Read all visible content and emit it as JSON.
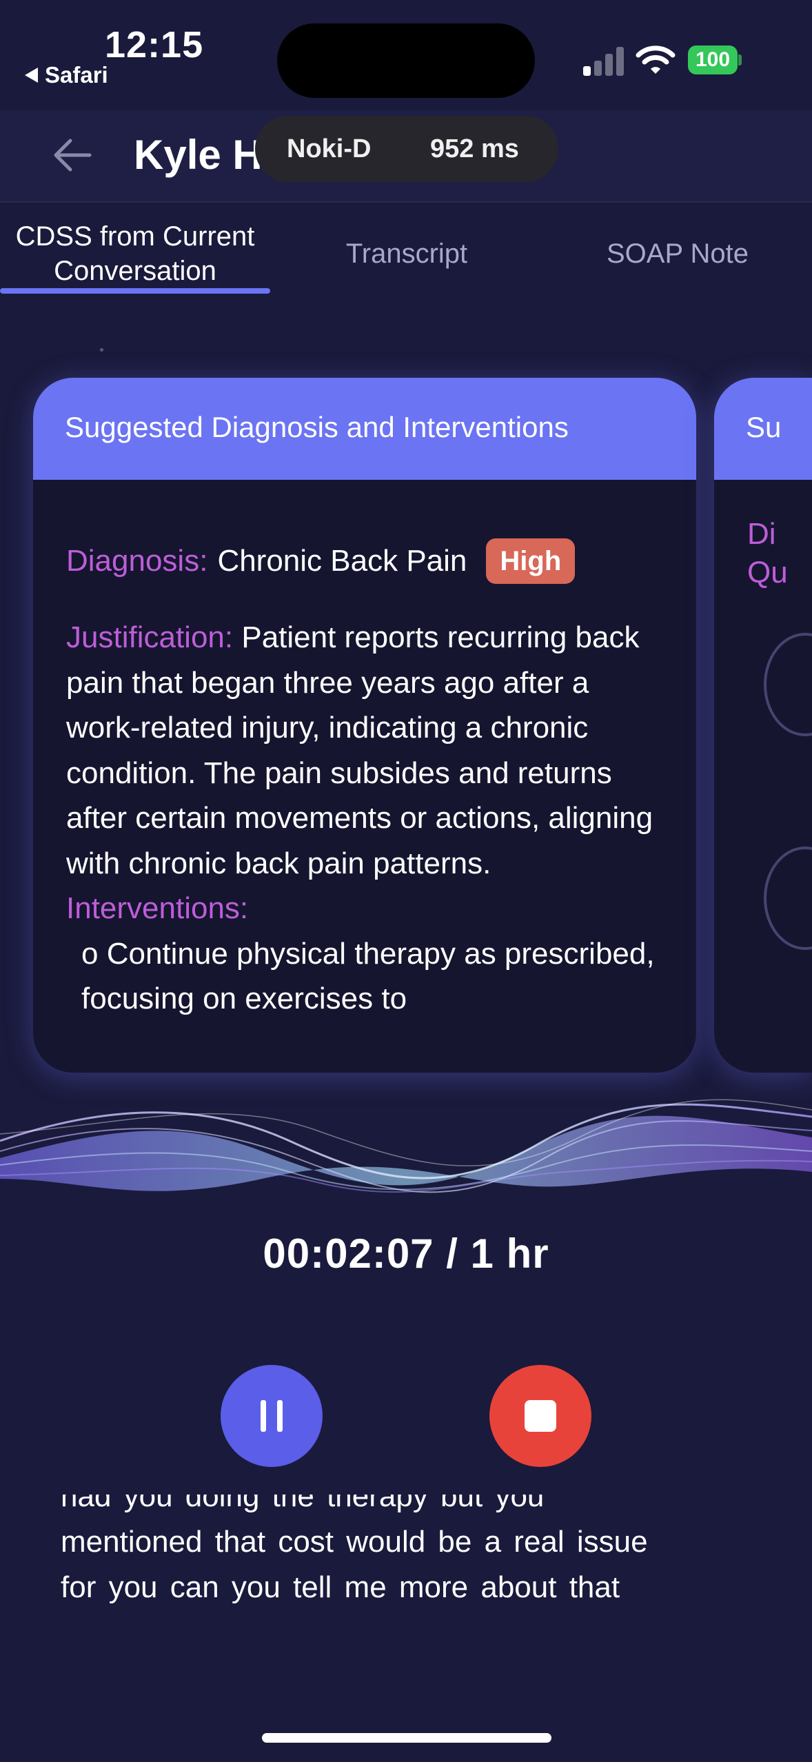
{
  "status_bar": {
    "time": "12:15",
    "back_app": "Safari",
    "battery": "100"
  },
  "header": {
    "patient_name": "Kyle H",
    "device": "Noki-D",
    "latency": "952 ms"
  },
  "tabs": [
    {
      "label": "CDSS from Current Conversation",
      "active": true
    },
    {
      "label": "Transcript",
      "active": false
    },
    {
      "label": "SOAP Note",
      "active": false
    }
  ],
  "card": {
    "title": "Suggested Diagnosis and Interventions",
    "diagnosis_label": "Diagnosis:",
    "diagnosis": "Chronic Back Pain",
    "confidence": "High",
    "justification_label": "Justification:",
    "justification": "Patient reports recurring back pain that began three years ago after a work-related injury, indicating a chronic condition. The pain subsides and returns after certain movements or actions, aligning with chronic back pain patterns.",
    "interventions_label": "Interventions:",
    "interventions": [
      "o Continue physical therapy as prescribed, focusing on exercises to"
    ]
  },
  "next_card": {
    "title": "Su",
    "label_line1": "Di",
    "label_line2": "Qu"
  },
  "recorder": {
    "elapsed": "00:02:07 / 1 hr"
  },
  "live_transcript": {
    "lines": [
      "had you doing the therapy but you",
      "mentioned that cost would be a real issue",
      "for you can you tell me more about that"
    ]
  },
  "colors": {
    "background": "#1a1a3c",
    "accent": "#6b74f2",
    "label": "#bd5ed8",
    "badge_high": "#d86858",
    "stop": "#e8433a",
    "pause": "#5b5ee8"
  }
}
